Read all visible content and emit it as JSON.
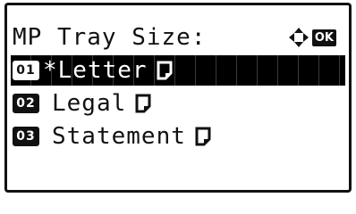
{
  "screen": {
    "title": "MP Tray Size:",
    "nav_icon": "four-way-arrow-icon",
    "ok_label": "OK"
  },
  "items": [
    {
      "number": "01",
      "label": "*Letter",
      "icon": "portrait-paper-icon",
      "selected": true
    },
    {
      "number": "02",
      "label": "Legal",
      "icon": "portrait-paper-icon",
      "selected": false
    },
    {
      "number": "03",
      "label": "Statement",
      "icon": "portrait-paper-icon",
      "selected": false
    }
  ],
  "colors": {
    "foreground": "#111111",
    "background": "#ffffff",
    "highlight": "#000000"
  }
}
